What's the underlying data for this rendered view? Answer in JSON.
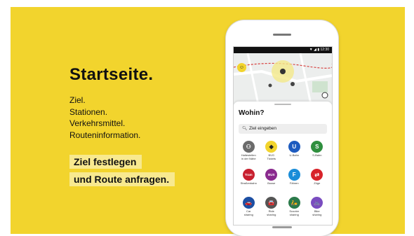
{
  "promo": {
    "headline": "Startseite.",
    "bullets": [
      "Ziel.",
      "Stationen.",
      "Verkehrsmittel.",
      "Routeninformation."
    ],
    "cta_line1": "Ziel festlegen",
    "cta_line2": "und Route anfragen."
  },
  "phone": {
    "status_time": "▼ ◢ ▮ 12:30",
    "avatar_icon": "person-icon",
    "sheet_title": "Wohin?",
    "search_placeholder": "Ziel eingeben",
    "tiles": [
      {
        "label": "Haltestellen\nin der Nähe",
        "glyph": "⚇",
        "color": "#6b6b6b",
        "name": "nearby-stops-icon"
      },
      {
        "label": "BVG\nTickets",
        "glyph": "◆",
        "color": "#f2d42d",
        "name": "tickets-icon"
      },
      {
        "label": "U-Bahn",
        "glyph": "U",
        "color": "#1d5bbf",
        "name": "ubahn-icon"
      },
      {
        "label": "S-Bahn",
        "glyph": "S",
        "color": "#2f8f3e",
        "name": "sbahn-icon"
      },
      {
        "label": "Straßenbahn",
        "glyph": "Tram",
        "color": "#c8202f",
        "name": "tram-icon"
      },
      {
        "label": "Busse",
        "glyph": "BUS",
        "color": "#8a2a8e",
        "name": "bus-icon"
      },
      {
        "label": "Fähren",
        "glyph": "F",
        "color": "#1b8dd8",
        "name": "ferry-icon"
      },
      {
        "label": "Züge",
        "glyph": "⇄",
        "color": "#d8232a",
        "name": "train-icon"
      },
      {
        "label": "Car\nsharing",
        "glyph": "🚗",
        "color": "#1c4fa3",
        "name": "car-sharing-icon"
      },
      {
        "label": "Ride\nsharing",
        "glyph": "🚘",
        "color": "#555555",
        "name": "ride-sharing-icon"
      },
      {
        "label": "Scooter\nsharing",
        "glyph": "🛵",
        "color": "#2b7a4a",
        "name": "scooter-sharing-icon"
      },
      {
        "label": "Bike\nsharing",
        "glyph": "🚲",
        "color": "#7a4cc0",
        "name": "bike-sharing-icon"
      }
    ]
  },
  "colors": {
    "brand_yellow": "#f2d42d",
    "highlight": "#f8e98f"
  }
}
